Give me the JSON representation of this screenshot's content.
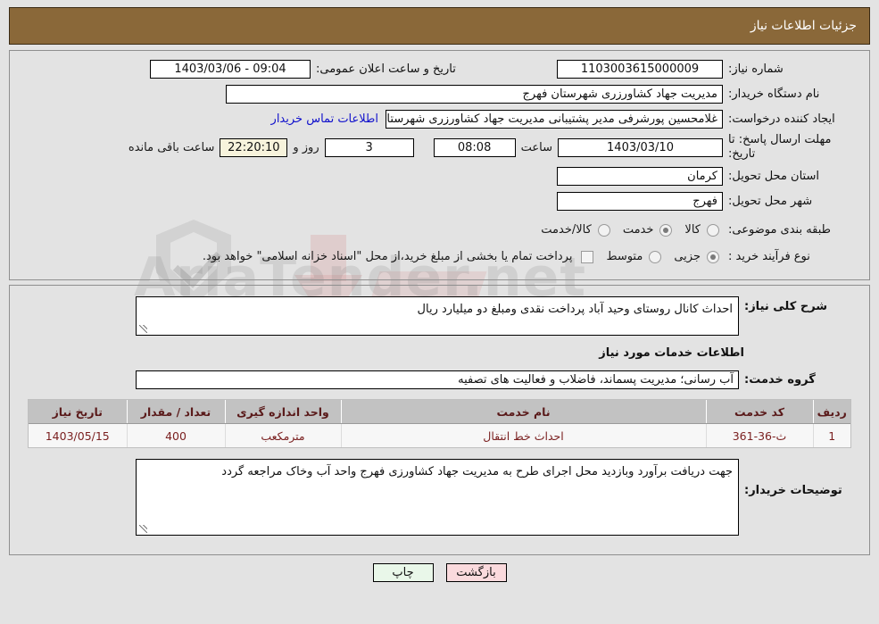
{
  "header": {
    "title": "جزئیات اطلاعات نیاز"
  },
  "top": {
    "need_number_label": "شماره نیاز:",
    "need_number_value": "1103003615000009",
    "public_announce_label": "تاریخ و ساعت اعلان عمومی:",
    "public_announce_value": "09:04 - 1403/03/06",
    "buyer_org_label": "نام دستگاه خریدار:",
    "buyer_org_value": "مدیریت جهاد کشاورزری شهرستان فهرج",
    "requester_label": "ایجاد کننده درخواست:",
    "requester_value": "غلامحسین پورشرفی مدیر پشتیبانی مدیریت جهاد کشاورزری شهرستان فهرج",
    "contact_link": "اطلاعات تماس خریدار",
    "deadline_label": "مهلت ارسال پاسخ: تا تاریخ:",
    "deadline_date": "1403/03/10",
    "deadline_hour_label": "ساعت",
    "deadline_hour": "08:08",
    "days_remaining": "3",
    "days_word": "روز و",
    "countdown": "22:20:10",
    "countdown_suffix": "ساعت باقی مانده",
    "province_label": "استان محل تحویل:",
    "province_value": "کرمان",
    "city_label": "شهر محل تحویل:",
    "city_value": "فهرج",
    "category_label": "طبقه بندی موضوعی:",
    "category_options": [
      {
        "label": "کالا",
        "selected": false
      },
      {
        "label": "خدمت",
        "selected": true
      },
      {
        "label": "کالا/خدمت",
        "selected": false
      }
    ],
    "process_label": "نوع فرآیند خرید :",
    "process_options": [
      {
        "label": "جزیی",
        "selected": true
      },
      {
        "label": "متوسط",
        "selected": false
      }
    ],
    "treasury_checkbox_checked": false,
    "treasury_note": "پرداخت تمام یا بخشی از مبلغ خرید،از محل \"اسناد خزانه اسلامی\" خواهد بود."
  },
  "bottom": {
    "general_desc_label": "شرح کلی نیاز:",
    "general_desc_value": "احداث کانال روستای وحید آباد پرداخت نقدی ومبلغ دو میلیارد ریال",
    "services_section_title": "اطلاعات خدمات مورد نیاز",
    "service_group_label": "گروه خدمت:",
    "service_group_value": "آب رسانی؛ مدیریت پسماند، فاضلاب و فعالیت های تصفیه",
    "table": {
      "columns": [
        "ردیف",
        "کد خدمت",
        "نام خدمت",
        "واحد اندازه گیری",
        "تعداد / مقدار",
        "تاریخ نیاز"
      ],
      "rows": [
        {
          "radif": "1",
          "code": "ث-36-361",
          "name": "احداث خط انتقال",
          "unit": "مترمکعب",
          "qty": "400",
          "need_date": "1403/05/15"
        }
      ]
    },
    "buyer_notes_label": "توضیحات خریدار:",
    "buyer_notes_value": "جهت دریافت برآورد وبازدید محل اجرای طرح به مدیریت جهاد کشاورزی فهرج واحد آب وخاک مراجعه گردد"
  },
  "footer": {
    "print_label": "چاپ",
    "back_label": "بازگشت"
  },
  "watermark": {
    "text": "AriaTender.net"
  },
  "colors": {
    "header_bg": "#8a6839",
    "link": "#1111cc",
    "table_header_bg": "#c2c2c2",
    "table_text": "#7a1f1f",
    "countdown_bg": "#f7f3dc",
    "print_btn_bg": "#e9f7e9",
    "back_btn_bg": "#fadadd"
  }
}
